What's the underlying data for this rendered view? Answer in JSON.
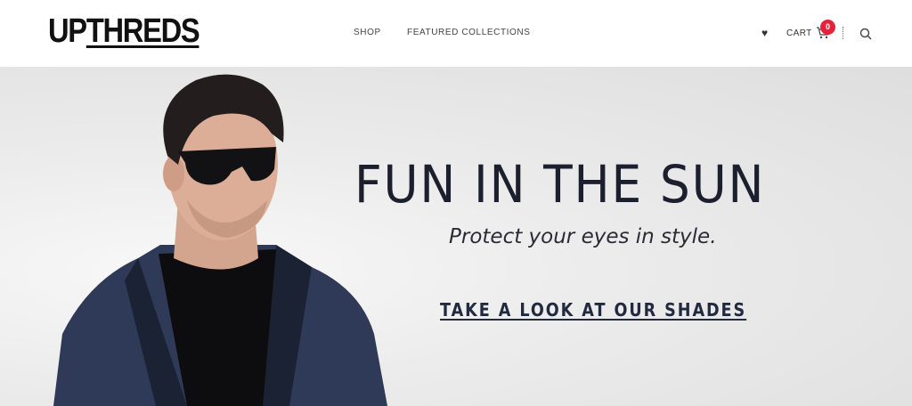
{
  "header": {
    "logo_part1": "UP",
    "logo_part2": "THREDS",
    "nav": {
      "shop": "SHOP",
      "featured": "FEATURED COLLECTIONS"
    },
    "cart_label": "CART",
    "cart_count": "0",
    "colors": {
      "badge": "#e8203b",
      "text": "#444444"
    }
  },
  "hero": {
    "title": "FUN IN THE SUN",
    "subtitle": "Protect your eyes in style.",
    "cta": "TAKE A LOOK AT OUR SHADES",
    "colors": {
      "title": "#1c1f2e",
      "cta": "#222a40",
      "background": "#e6e6e6"
    }
  },
  "icons": [
    "heart-icon",
    "cart-icon",
    "search-icon",
    "hero-model-image"
  ]
}
